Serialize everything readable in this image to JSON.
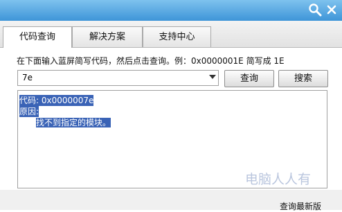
{
  "titlebar": {
    "search_icon": "magnifier-icon",
    "close_icon": "close-icon",
    "color": "#3e95d8"
  },
  "tabs": [
    {
      "label": "代码查询",
      "active": true
    },
    {
      "label": "解决方案",
      "active": false
    },
    {
      "label": "支持中心",
      "active": false
    }
  ],
  "instruction": "在下面输入蓝屏简写代码，然后点击查询。例：0x0000001E 简写成 1E",
  "code_input": {
    "value": "7e"
  },
  "buttons": {
    "query": "查询",
    "search": "搜索"
  },
  "result": {
    "code_line": "代码: 0x0000007e",
    "reason_label": "原因:",
    "reason_text": "找不到指定的模块。",
    "highlight_color": "#3a63b6"
  },
  "watermark": "电脑人人有",
  "footer": {
    "update_link": "查询最新版"
  }
}
